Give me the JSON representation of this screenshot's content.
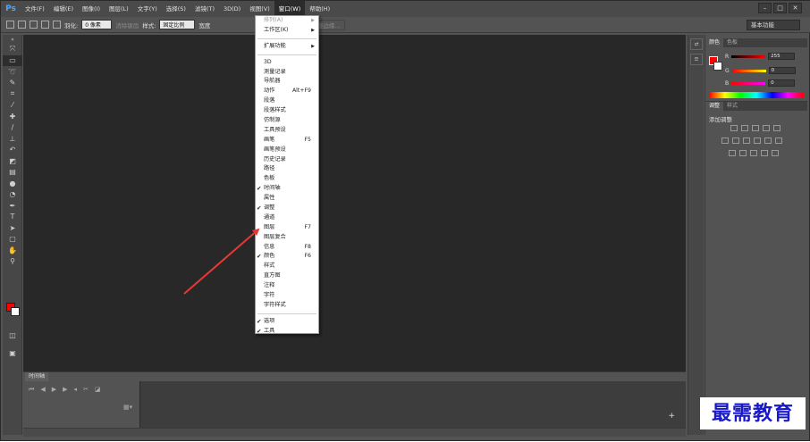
{
  "menubar": {
    "logo": "Ps",
    "items": [
      "文件(F)",
      "编辑(E)",
      "图像(I)",
      "图层(L)",
      "文字(Y)",
      "选择(S)",
      "滤镜(T)",
      "3D(D)",
      "视图(V)",
      "窗口(W)",
      "帮助(H)"
    ],
    "active_item": "窗口(W)"
  },
  "window_controls": {
    "minimize": "–",
    "restore": "□",
    "close": "✕"
  },
  "options_bar": {
    "feather_label": "羽化:",
    "feather_value": "0 像素",
    "antialias_label": "消除锯齿",
    "style_label": "样式:",
    "style_value": "固定比例",
    "width_label": "宽度",
    "height_value": "00",
    "refine_edge": "调整边缘..."
  },
  "workspace_select": "基本功能",
  "window_menu": {
    "arrange": "排列(A)",
    "workspace": "工作区(K)",
    "extensions": "扩展功能",
    "items": [
      {
        "label": "3D",
        "shortcut": "",
        "checked": false
      },
      {
        "label": "测量记录",
        "shortcut": "",
        "checked": false
      },
      {
        "label": "导航器",
        "shortcut": "",
        "checked": false
      },
      {
        "label": "动作",
        "shortcut": "Alt+F9",
        "checked": false
      },
      {
        "label": "段落",
        "shortcut": "",
        "checked": false
      },
      {
        "label": "段落样式",
        "shortcut": "",
        "checked": false
      },
      {
        "label": "仿制源",
        "shortcut": "",
        "checked": false
      },
      {
        "label": "工具预设",
        "shortcut": "",
        "checked": false
      },
      {
        "label": "画笔",
        "shortcut": "F5",
        "checked": false
      },
      {
        "label": "画笔预设",
        "shortcut": "",
        "checked": false
      },
      {
        "label": "历史记录",
        "shortcut": "",
        "checked": false
      },
      {
        "label": "路径",
        "shortcut": "",
        "checked": false
      },
      {
        "label": "色板",
        "shortcut": "",
        "checked": false
      },
      {
        "label": "时间轴",
        "shortcut": "",
        "checked": true
      },
      {
        "label": "属性",
        "shortcut": "",
        "checked": false
      },
      {
        "label": "调整",
        "shortcut": "",
        "checked": true
      },
      {
        "label": "通道",
        "shortcut": "",
        "checked": false
      },
      {
        "label": "图层",
        "shortcut": "F7",
        "checked": false
      },
      {
        "label": "图层复合",
        "shortcut": "",
        "checked": false
      },
      {
        "label": "信息",
        "shortcut": "F8",
        "checked": false
      },
      {
        "label": "颜色",
        "shortcut": "F6",
        "checked": true
      },
      {
        "label": "样式",
        "shortcut": "",
        "checked": false
      },
      {
        "label": "直方图",
        "shortcut": "",
        "checked": false
      },
      {
        "label": "注释",
        "shortcut": "",
        "checked": false
      },
      {
        "label": "字符",
        "shortcut": "",
        "checked": false
      },
      {
        "label": "字符样式",
        "shortcut": "",
        "checked": false
      }
    ],
    "footer_items": [
      {
        "label": "选项",
        "checked": true
      },
      {
        "label": "工具",
        "checked": true
      }
    ]
  },
  "panels": {
    "color_tabs": [
      "颜色",
      "色板"
    ],
    "rgb": [
      {
        "channel": "R",
        "value": "255"
      },
      {
        "channel": "G",
        "value": "0"
      },
      {
        "channel": "B",
        "value": "0"
      }
    ],
    "adjust_tabs": [
      "调整",
      "样式"
    ],
    "adjust_title": "添加调整"
  },
  "timeline": {
    "tab": "时间轴"
  },
  "watermark": "最需教育",
  "colors": {
    "accent": "#ff0000",
    "arrow": "#e53935",
    "watermark": "#1818c8"
  }
}
